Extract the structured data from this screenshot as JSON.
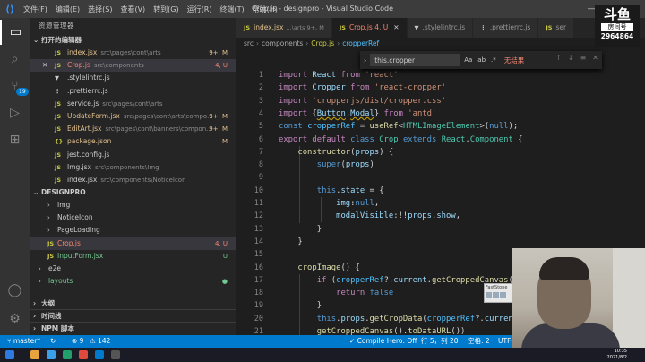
{
  "window": {
    "title": "Crop.js - designpro - Visual Studio Code",
    "menu": [
      "文件(F)",
      "编辑(E)",
      "选择(S)",
      "查看(V)",
      "转到(G)",
      "运行(R)",
      "终端(T)",
      "帮助(H)"
    ],
    "controls": [
      "—",
      "□",
      "✕"
    ]
  },
  "activity_bar": {
    "items": [
      "explorer-icon",
      "search-icon",
      "source-control-icon",
      "run-debug-icon",
      "extensions-icon"
    ],
    "badge": "19",
    "bottom": [
      "account-icon",
      "settings-icon"
    ]
  },
  "sidebar": {
    "title": "资源管理器",
    "open_editors": {
      "label": "打开的编辑器",
      "items": [
        {
          "icon": "JS",
          "name": "index.jsx",
          "path": "src\\pages\\cont\\arts",
          "status": "9+, M",
          "color": "mod"
        },
        {
          "icon": "JS",
          "name": "Crop.js",
          "path": "src\\components",
          "status": "4, U",
          "color": "err",
          "close": "✕"
        },
        {
          "icon": "▼",
          "name": ".stylelintrc.js",
          "path": "",
          "status": "",
          "color": "plain"
        },
        {
          "icon": "⋮",
          "name": ".prettierrc.js",
          "path": "",
          "status": "",
          "color": "plain"
        },
        {
          "icon": "JS",
          "name": "service.js",
          "path": "src\\pages\\cont\\arts",
          "status": "",
          "color": "plain"
        },
        {
          "icon": "JS",
          "name": "UpdateForm.jsx",
          "path": "src\\pages\\cont\\arts\\compo...",
          "status": "9+, M",
          "color": "mod"
        },
        {
          "icon": "JS",
          "name": "EditArt.jsx",
          "path": "src\\pages\\cont\\banners\\compon...",
          "status": "9+, M",
          "color": "mod"
        },
        {
          "icon": "{}",
          "name": "package.json",
          "path": "",
          "status": "M",
          "color": "mod"
        },
        {
          "icon": "JS",
          "name": "jest.config.js",
          "path": "",
          "status": "",
          "color": "plain"
        },
        {
          "icon": "JS",
          "name": "Img.jsx",
          "path": "src\\components\\Img",
          "status": "",
          "color": "plain"
        },
        {
          "icon": "JS",
          "name": "index.jsx",
          "path": "src\\components\\NoticeIcon",
          "status": "",
          "color": "plain"
        }
      ]
    },
    "project": {
      "label": "DESIGNPRO",
      "items": [
        {
          "type": "folder",
          "name": "Img",
          "status": "",
          "color": "plain",
          "indent": 1
        },
        {
          "type": "folder",
          "name": "NoticeIcon",
          "status": "",
          "color": "plain",
          "indent": 1
        },
        {
          "type": "folder",
          "name": "PageLoading",
          "status": "",
          "color": "plain",
          "indent": 1
        },
        {
          "type": "file",
          "icon": "JS",
          "name": "Crop.js",
          "status": "4, U",
          "color": "err",
          "indent": 1,
          "selected": true
        },
        {
          "type": "file",
          "icon": "JS",
          "name": "InputForm.jsx",
          "status": "U",
          "color": "untracked",
          "indent": 1
        },
        {
          "type": "folder",
          "name": "e2e",
          "status": "",
          "color": "plain",
          "indent": 0
        },
        {
          "type": "folder",
          "name": "layouts",
          "status": "●",
          "color": "untracked",
          "indent": 0
        }
      ]
    },
    "bottom_sections": [
      "大纲",
      "时间线",
      "NPM 脚本"
    ]
  },
  "tabs": [
    {
      "icon": "JS",
      "name": "index.jsx",
      "sub": "...\\arts 9+, M",
      "active": false
    },
    {
      "icon": "JS",
      "name": "Crop.js 4, U",
      "sub": "",
      "active": true,
      "close": "✕"
    },
    {
      "icon": "▼",
      "name": ".stylelintrc.js",
      "sub": "",
      "active": false
    },
    {
      "icon": "⋮",
      "name": ".prettierrc.js",
      "sub": "",
      "active": false
    },
    {
      "icon": "JS",
      "name": "ser",
      "sub": "",
      "active": false
    }
  ],
  "breadcrumb": [
    "src",
    "components",
    "Crop.js",
    "cropperRef"
  ],
  "find": {
    "value": "this.cropper",
    "options": [
      "Aa",
      "ab",
      ".*"
    ],
    "result": "无结果",
    "buttons": [
      "↑",
      "↓",
      "≡",
      "✕"
    ]
  },
  "editor": {
    "start_line": 1,
    "lines": [
      [
        [
          "k1",
          "import "
        ],
        [
          "id",
          "React"
        ],
        [
          "k1",
          " from "
        ],
        [
          "str",
          "'react'"
        ]
      ],
      [
        [
          "k1",
          "import "
        ],
        [
          "id",
          "Cropper"
        ],
        [
          "k1",
          " from "
        ],
        [
          "str",
          "'react-cropper'"
        ]
      ],
      [
        [
          "k1",
          "import "
        ],
        [
          "str",
          "'cropperjs/dist/cropper.css'"
        ]
      ],
      [
        [
          "k1",
          "import "
        ],
        [
          "pl",
          "{"
        ],
        [
          "id",
          "Button"
        ],
        [
          "pl",
          ","
        ],
        [
          "id",
          "Modal"
        ],
        [
          "pl",
          "} "
        ],
        [
          "k1",
          "from "
        ],
        [
          "str",
          "'antd'"
        ]
      ],
      [
        [
          "k2",
          "const "
        ],
        [
          "cst",
          "cropperRef"
        ],
        [
          "pl",
          " = "
        ],
        [
          "fn",
          "useRef"
        ],
        [
          "pl",
          "<"
        ],
        [
          "cls",
          "HTMLImageElement"
        ],
        [
          "pl",
          ">("
        ],
        [
          "k2",
          "null"
        ],
        [
          "pl",
          ");"
        ]
      ],
      [
        [
          "k1",
          "export "
        ],
        [
          "k1",
          "default "
        ],
        [
          "k2",
          "class "
        ],
        [
          "cls",
          "Crop "
        ],
        [
          "k2",
          "extends "
        ],
        [
          "cls",
          "React"
        ],
        [
          "pl",
          "."
        ],
        [
          "cls",
          "Component"
        ],
        [
          "pl",
          " {"
        ]
      ],
      [
        [
          "pl",
          "    "
        ],
        [
          "fn",
          "constructor"
        ],
        [
          "pl",
          "("
        ],
        [
          "id",
          "props"
        ],
        [
          "pl",
          ") {"
        ]
      ],
      [
        [
          "pl",
          "        "
        ],
        [
          "k2",
          "super"
        ],
        [
          "pl",
          "("
        ],
        [
          "id",
          "props"
        ],
        [
          "pl",
          ")"
        ]
      ],
      [
        [
          "pl",
          ""
        ]
      ],
      [
        [
          "pl",
          "        "
        ],
        [
          "k2",
          "this"
        ],
        [
          "pl",
          "."
        ],
        [
          "id",
          "state"
        ],
        [
          "pl",
          " = {"
        ]
      ],
      [
        [
          "pl",
          "            "
        ],
        [
          "id",
          "img"
        ],
        [
          "pl",
          ":"
        ],
        [
          "k2",
          "null"
        ],
        [
          "pl",
          ","
        ]
      ],
      [
        [
          "pl",
          "            "
        ],
        [
          "id",
          "modalVisible"
        ],
        [
          "pl",
          ":!!"
        ],
        [
          "id",
          "props"
        ],
        [
          "pl",
          "."
        ],
        [
          "id",
          "show"
        ],
        [
          "pl",
          ","
        ]
      ],
      [
        [
          "pl",
          "        }"
        ]
      ],
      [
        [
          "pl",
          "    }"
        ]
      ],
      [
        [
          "pl",
          ""
        ]
      ],
      [
        [
          "pl",
          "    "
        ],
        [
          "fn",
          "cropImage"
        ],
        [
          "pl",
          "() {"
        ]
      ],
      [
        [
          "pl",
          "        "
        ],
        [
          "k1",
          "if "
        ],
        [
          "pl",
          "("
        ],
        [
          "cst",
          "cropperRef"
        ],
        [
          "pl",
          "?."
        ],
        [
          "id",
          "current"
        ],
        [
          "pl",
          "."
        ],
        [
          "fn",
          "getCroppedCanvas"
        ],
        [
          "pl",
          "() == null) {"
        ]
      ],
      [
        [
          "pl",
          "            "
        ],
        [
          "k1",
          "return "
        ],
        [
          "k2",
          "false"
        ]
      ],
      [
        [
          "pl",
          "        }"
        ]
      ],
      [
        [
          "pl",
          "        "
        ],
        [
          "k2",
          "this"
        ],
        [
          "pl",
          "."
        ],
        [
          "id",
          "props"
        ],
        [
          "pl",
          "."
        ],
        [
          "fn",
          "getCropData"
        ],
        [
          "pl",
          "("
        ],
        [
          "cst",
          "cropperRef"
        ],
        [
          "pl",
          "?."
        ],
        [
          "id",
          "current"
        ],
        [
          "pl",
          "."
        ],
        [
          "fn",
          "getCroppedCanvas"
        ],
        [
          "pl",
          "()"
        ]
      ],
      [
        [
          "pl",
          "        "
        ],
        [
          "fn",
          "getCroppedCanvas"
        ],
        [
          "pl",
          "()."
        ],
        [
          "fn",
          "toDataURL"
        ],
        [
          "pl",
          "())"
        ]
      ]
    ]
  },
  "statusbar": {
    "branch": "master*",
    "sync": "↻",
    "errors": "⊗ 9",
    "warnings": "⚠ 142",
    "extension": "✓ Compile Hero: Off",
    "position": "行 5，列 20",
    "spaces": "空格: 2",
    "encoding": "UTF-8"
  },
  "overlay": {
    "logo_glyph": "斗鱼",
    "logo_sub": "房间号",
    "room": "2964864",
    "fs_title": "FastStone"
  },
  "taskbar": {
    "time": "10:35",
    "date": "2021/8/2"
  },
  "colors": {
    "accent": "#007acc",
    "error": "#f48771",
    "modified": "#e2c08d",
    "untracked": "#73c991"
  }
}
